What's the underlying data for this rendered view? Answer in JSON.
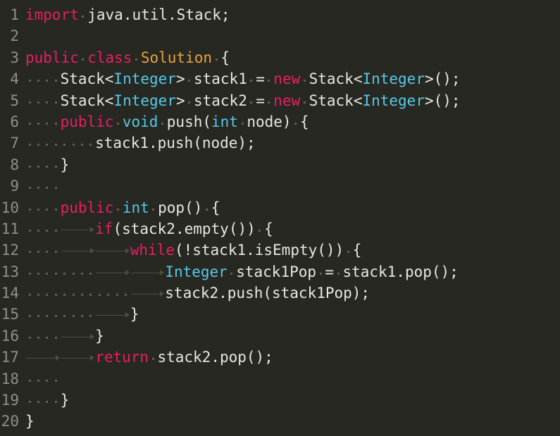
{
  "editor": {
    "language": "Java",
    "theme": "monokai-dark",
    "background_color": "#272818",
    "text_color": "#e8e8e3",
    "gutter_color": "#8f9088",
    "whitespace_marker_color": "#5e5f57",
    "total_lines": 20,
    "colors": {
      "keyword": "#e91e63",
      "type": "#56c8e8",
      "class_name": "#e8a33d",
      "plain": "#e8e8e3"
    },
    "lines": [
      {
        "number": "1",
        "tokens": [
          {
            "t": "import",
            "c": "kw"
          },
          {
            "t": " ",
            "c": "space"
          },
          {
            "t": "java.util.Stack;",
            "c": "plain"
          }
        ]
      },
      {
        "number": "2",
        "tokens": []
      },
      {
        "number": "3",
        "tokens": [
          {
            "t": "public",
            "c": "kw"
          },
          {
            "t": " ",
            "c": "space"
          },
          {
            "t": "class",
            "c": "kw"
          },
          {
            "t": " ",
            "c": "space"
          },
          {
            "t": "Solution",
            "c": "name"
          },
          {
            "t": " ",
            "c": "space"
          },
          {
            "t": "{",
            "c": "plain"
          }
        ]
      },
      {
        "number": "4",
        "tokens": [
          {
            "t": " ",
            "c": "space"
          },
          {
            "t": " ",
            "c": "space"
          },
          {
            "t": " ",
            "c": "space"
          },
          {
            "t": " ",
            "c": "space"
          },
          {
            "t": "Stack<",
            "c": "plain"
          },
          {
            "t": "Integer",
            "c": "type"
          },
          {
            "t": ">",
            "c": "plain"
          },
          {
            "t": " ",
            "c": "space"
          },
          {
            "t": "stack1",
            "c": "plain"
          },
          {
            "t": " ",
            "c": "space"
          },
          {
            "t": "=",
            "c": "plain"
          },
          {
            "t": " ",
            "c": "space"
          },
          {
            "t": "new",
            "c": "kw"
          },
          {
            "t": " ",
            "c": "space"
          },
          {
            "t": "Stack<",
            "c": "plain"
          },
          {
            "t": "Integer",
            "c": "type"
          },
          {
            "t": ">();",
            "c": "plain"
          }
        ]
      },
      {
        "number": "5",
        "tokens": [
          {
            "t": " ",
            "c": "space"
          },
          {
            "t": " ",
            "c": "space"
          },
          {
            "t": " ",
            "c": "space"
          },
          {
            "t": " ",
            "c": "space"
          },
          {
            "t": "Stack<",
            "c": "plain"
          },
          {
            "t": "Integer",
            "c": "type"
          },
          {
            "t": ">",
            "c": "plain"
          },
          {
            "t": " ",
            "c": "space"
          },
          {
            "t": "stack2",
            "c": "plain"
          },
          {
            "t": " ",
            "c": "space"
          },
          {
            "t": "=",
            "c": "plain"
          },
          {
            "t": " ",
            "c": "space"
          },
          {
            "t": "new",
            "c": "kw"
          },
          {
            "t": " ",
            "c": "space"
          },
          {
            "t": "Stack<",
            "c": "plain"
          },
          {
            "t": "Integer",
            "c": "type"
          },
          {
            "t": ">();",
            "c": "plain"
          }
        ]
      },
      {
        "number": "6",
        "tokens": [
          {
            "t": " ",
            "c": "space"
          },
          {
            "t": " ",
            "c": "space"
          },
          {
            "t": " ",
            "c": "space"
          },
          {
            "t": " ",
            "c": "space"
          },
          {
            "t": "public",
            "c": "kw"
          },
          {
            "t": " ",
            "c": "space"
          },
          {
            "t": "void",
            "c": "type"
          },
          {
            "t": " ",
            "c": "space"
          },
          {
            "t": "push(",
            "c": "plain"
          },
          {
            "t": "int",
            "c": "type"
          },
          {
            "t": " ",
            "c": "space"
          },
          {
            "t": "node)",
            "c": "plain"
          },
          {
            "t": " ",
            "c": "space"
          },
          {
            "t": "{",
            "c": "plain"
          }
        ]
      },
      {
        "number": "7",
        "tokens": [
          {
            "t": " ",
            "c": "space"
          },
          {
            "t": " ",
            "c": "space"
          },
          {
            "t": " ",
            "c": "space"
          },
          {
            "t": " ",
            "c": "space"
          },
          {
            "t": " ",
            "c": "space"
          },
          {
            "t": " ",
            "c": "space"
          },
          {
            "t": " ",
            "c": "space"
          },
          {
            "t": " ",
            "c": "space"
          },
          {
            "t": "stack1.push(node);",
            "c": "plain"
          }
        ]
      },
      {
        "number": "8",
        "tokens": [
          {
            "t": " ",
            "c": "space"
          },
          {
            "t": " ",
            "c": "space"
          },
          {
            "t": " ",
            "c": "space"
          },
          {
            "t": " ",
            "c": "space"
          },
          {
            "t": "}",
            "c": "plain"
          }
        ]
      },
      {
        "number": "9",
        "tokens": [
          {
            "t": " ",
            "c": "space"
          },
          {
            "t": " ",
            "c": "space"
          },
          {
            "t": " ",
            "c": "space"
          },
          {
            "t": " ",
            "c": "space"
          }
        ]
      },
      {
        "number": "10",
        "tokens": [
          {
            "t": " ",
            "c": "space"
          },
          {
            "t": " ",
            "c": "space"
          },
          {
            "t": " ",
            "c": "space"
          },
          {
            "t": " ",
            "c": "space"
          },
          {
            "t": "public",
            "c": "kw"
          },
          {
            "t": " ",
            "c": "space"
          },
          {
            "t": "int",
            "c": "type"
          },
          {
            "t": " ",
            "c": "space"
          },
          {
            "t": "pop()",
            "c": "plain"
          },
          {
            "t": " ",
            "c": "space"
          },
          {
            "t": "{",
            "c": "plain"
          }
        ]
      },
      {
        "number": "11",
        "tokens": [
          {
            "t": " ",
            "c": "space"
          },
          {
            "t": " ",
            "c": "space"
          },
          {
            "t": " ",
            "c": "space"
          },
          {
            "t": " ",
            "c": "space"
          },
          {
            "t": "\t",
            "c": "tab",
            "w": "w1"
          },
          {
            "t": "if",
            "c": "kw"
          },
          {
            "t": "(stack2.empty())",
            "c": "plain"
          },
          {
            "t": " ",
            "c": "space"
          },
          {
            "t": "{",
            "c": "plain"
          }
        ]
      },
      {
        "number": "12",
        "tokens": [
          {
            "t": " ",
            "c": "space"
          },
          {
            "t": " ",
            "c": "space"
          },
          {
            "t": " ",
            "c": "space"
          },
          {
            "t": " ",
            "c": "space"
          },
          {
            "t": "\t",
            "c": "tab",
            "w": "w1"
          },
          {
            "t": "\t",
            "c": "tab",
            "w": "w1"
          },
          {
            "t": "while",
            "c": "kw"
          },
          {
            "t": "(!stack1.isEmpty())",
            "c": "plain"
          },
          {
            "t": " ",
            "c": "space"
          },
          {
            "t": "{",
            "c": "plain"
          }
        ]
      },
      {
        "number": "13",
        "tokens": [
          {
            "t": " ",
            "c": "space"
          },
          {
            "t": " ",
            "c": "space"
          },
          {
            "t": " ",
            "c": "space"
          },
          {
            "t": " ",
            "c": "space"
          },
          {
            "t": " ",
            "c": "space"
          },
          {
            "t": " ",
            "c": "space"
          },
          {
            "t": " ",
            "c": "space"
          },
          {
            "t": " ",
            "c": "space"
          },
          {
            "t": "\t",
            "c": "tab",
            "w": "w1"
          },
          {
            "t": "\t",
            "c": "tab",
            "w": "w1"
          },
          {
            "t": "Integer",
            "c": "type"
          },
          {
            "t": " ",
            "c": "space"
          },
          {
            "t": "stack1Pop",
            "c": "plain"
          },
          {
            "t": " ",
            "c": "space"
          },
          {
            "t": "=",
            "c": "plain"
          },
          {
            "t": " ",
            "c": "space"
          },
          {
            "t": "stack1.pop();",
            "c": "plain"
          }
        ]
      },
      {
        "number": "14",
        "tokens": [
          {
            "t": " ",
            "c": "space"
          },
          {
            "t": " ",
            "c": "space"
          },
          {
            "t": " ",
            "c": "space"
          },
          {
            "t": " ",
            "c": "space"
          },
          {
            "t": " ",
            "c": "space"
          },
          {
            "t": " ",
            "c": "space"
          },
          {
            "t": " ",
            "c": "space"
          },
          {
            "t": " ",
            "c": "space"
          },
          {
            "t": " ",
            "c": "space"
          },
          {
            "t": " ",
            "c": "space"
          },
          {
            "t": " ",
            "c": "space"
          },
          {
            "t": " ",
            "c": "space"
          },
          {
            "t": "\t",
            "c": "tab",
            "w": "w1"
          },
          {
            "t": "stack2.push(stack1Pop);",
            "c": "plain"
          }
        ]
      },
      {
        "number": "15",
        "tokens": [
          {
            "t": " ",
            "c": "space"
          },
          {
            "t": " ",
            "c": "space"
          },
          {
            "t": " ",
            "c": "space"
          },
          {
            "t": " ",
            "c": "space"
          },
          {
            "t": " ",
            "c": "space"
          },
          {
            "t": " ",
            "c": "space"
          },
          {
            "t": " ",
            "c": "space"
          },
          {
            "t": " ",
            "c": "space"
          },
          {
            "t": "\t",
            "c": "tab",
            "w": "w1"
          },
          {
            "t": "}",
            "c": "plain"
          }
        ]
      },
      {
        "number": "16",
        "tokens": [
          {
            "t": " ",
            "c": "space"
          },
          {
            "t": " ",
            "c": "space"
          },
          {
            "t": " ",
            "c": "space"
          },
          {
            "t": " ",
            "c": "space"
          },
          {
            "t": "\t",
            "c": "tab",
            "w": "w1"
          },
          {
            "t": "}",
            "c": "plain"
          }
        ]
      },
      {
        "number": "17",
        "tokens": [
          {
            "t": "\t",
            "c": "tab",
            "w": "w1"
          },
          {
            "t": "\t",
            "c": "tab",
            "w": "w1"
          },
          {
            "t": "return",
            "c": "kw"
          },
          {
            "t": " ",
            "c": "space"
          },
          {
            "t": "stack2.pop();",
            "c": "plain"
          }
        ]
      },
      {
        "number": "18",
        "tokens": [
          {
            "t": " ",
            "c": "space"
          },
          {
            "t": " ",
            "c": "space"
          },
          {
            "t": " ",
            "c": "space"
          },
          {
            "t": " ",
            "c": "space"
          }
        ]
      },
      {
        "number": "19",
        "tokens": [
          {
            "t": " ",
            "c": "space"
          },
          {
            "t": " ",
            "c": "space"
          },
          {
            "t": " ",
            "c": "space"
          },
          {
            "t": " ",
            "c": "space"
          },
          {
            "t": "}",
            "c": "plain"
          }
        ]
      },
      {
        "number": "20",
        "tokens": [
          {
            "t": "}",
            "c": "plain"
          }
        ]
      }
    ]
  }
}
